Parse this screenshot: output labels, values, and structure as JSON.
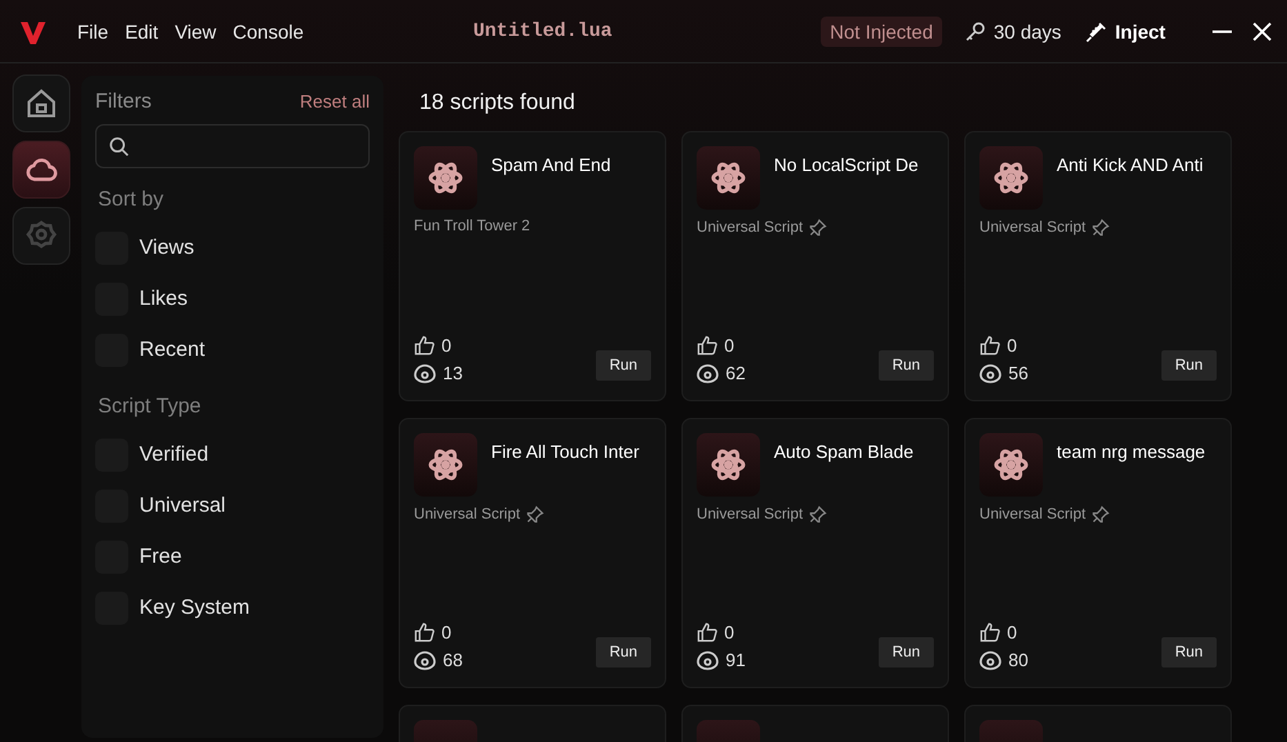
{
  "title_bar": {
    "menu": [
      "File",
      "Edit",
      "View",
      "Console"
    ],
    "file_name": "Untitled.lua",
    "status": "Not Injected",
    "license": "30 days",
    "inject": "Inject"
  },
  "nav": [
    {
      "kind": "home",
      "selected": false
    },
    {
      "kind": "cloud",
      "selected": true
    },
    {
      "kind": "settings",
      "selected": false
    }
  ],
  "filters": {
    "title": "Filters",
    "reset": "Reset all",
    "sort_title": "Sort by",
    "sort": [
      {
        "label": "Views",
        "checked": false
      },
      {
        "label": "Likes",
        "checked": false
      },
      {
        "label": "Recent",
        "checked": false
      }
    ],
    "type_title": "Script Type",
    "types": [
      {
        "label": "Verified",
        "checked": false
      },
      {
        "label": "Universal",
        "checked": false
      },
      {
        "label": "Free",
        "checked": false
      },
      {
        "label": "Key System",
        "checked": false
      }
    ]
  },
  "results": "18 scripts found",
  "cards": [
    {
      "kind": "full",
      "title": "Spam And End",
      "game": "Fun Troll Tower 2",
      "universal": false,
      "likes": "0",
      "views": "13",
      "button": "Run"
    },
    {
      "kind": "full",
      "title": "No LocalScript De",
      "game": "Universal Script",
      "universal": true,
      "likes": "0",
      "views": "62",
      "button": "Run"
    },
    {
      "kind": "full",
      "title": "Anti Kick AND Anti",
      "game": "Universal Script",
      "universal": true,
      "likes": "0",
      "views": "56",
      "button": "Run"
    },
    {
      "kind": "full",
      "title": "Fire All Touch Inter",
      "game": "Universal Script",
      "universal": true,
      "likes": "0",
      "views": "68",
      "button": "Run"
    },
    {
      "kind": "full",
      "title": "Auto Spam Blade",
      "game": "Universal Script",
      "universal": true,
      "likes": "0",
      "views": "91",
      "button": "Run"
    },
    {
      "kind": "full",
      "title": "team nrg message",
      "game": "Universal Script",
      "universal": true,
      "likes": "0",
      "views": "80",
      "button": "Run"
    },
    {
      "kind": "partial"
    },
    {
      "kind": "partial"
    },
    {
      "kind": "partial"
    }
  ]
}
